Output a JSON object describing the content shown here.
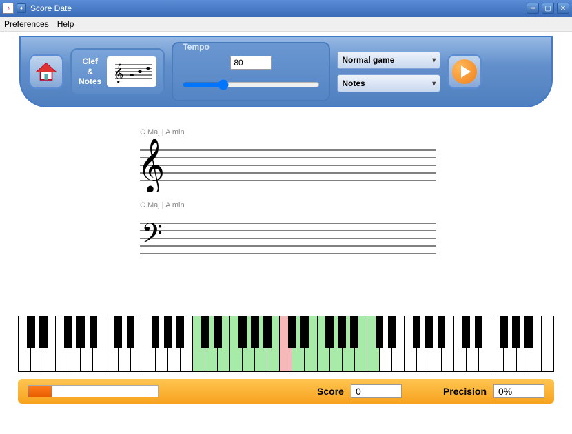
{
  "window": {
    "title": "Score Date"
  },
  "menu": {
    "preferences": "Preferences",
    "help": "Help"
  },
  "toolbar": {
    "clef_notes_label_1": "Clef",
    "clef_notes_label_amp": "&",
    "clef_notes_label_2": "Notes",
    "tempo_label": "Tempo",
    "tempo_value": "80",
    "game_mode": "Normal game",
    "quiz_type": "Notes"
  },
  "staff": {
    "treble_key": "C Maj | A min",
    "bass_key": "C Maj | A min"
  },
  "piano": {
    "white_key_count": 43,
    "highlighted_green_white": [
      14,
      15,
      16,
      17,
      18,
      19,
      20,
      22,
      23,
      24,
      25,
      26,
      27,
      28
    ],
    "highlighted_pink_white": [
      21
    ],
    "black_pattern": [
      1,
      1,
      0,
      1,
      1,
      1,
      0
    ]
  },
  "status": {
    "score_label": "Score",
    "score_value": "0",
    "precision_label": "Precision",
    "precision_value": "0%",
    "progress_percent": 18
  }
}
